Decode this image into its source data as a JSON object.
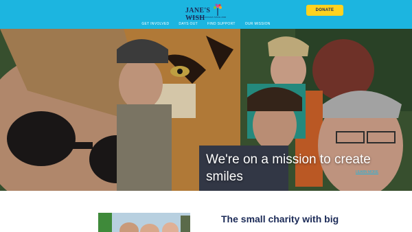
{
  "header": {
    "logo_text": "JANE'S WISH",
    "logo_tagline": "SUPPORTING FAMILIES SINCE 2000",
    "donate_label": "DONATE",
    "brand_color": "#1cb5e0",
    "donate_color": "#ffd21f"
  },
  "nav": {
    "items": [
      {
        "label": "GET INVOLVED"
      },
      {
        "label": "DAYS OUT"
      },
      {
        "label": "FIND SUPPORT"
      },
      {
        "label": "OUR MISSION"
      }
    ]
  },
  "hero": {
    "title": "We're on a mission to create smiles",
    "link_label": "LEARN MORE"
  },
  "intro": {
    "heading": "The small charity with big"
  }
}
